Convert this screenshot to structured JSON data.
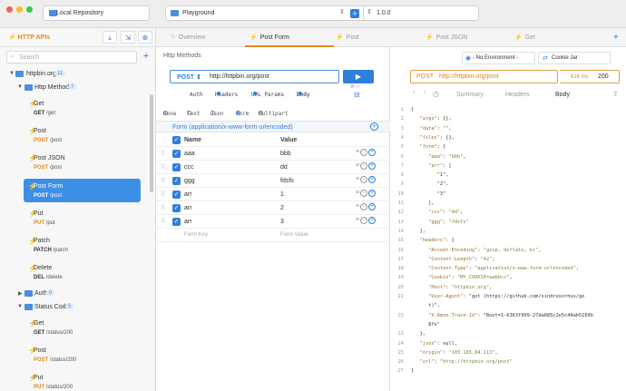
{
  "titlebar": {
    "repository": "Local Repository",
    "project": "Playground",
    "version": "1.0.0"
  },
  "sidebar": {
    "title": "HTTP APIs",
    "search_placeholder": "Search",
    "tree": {
      "root": {
        "label": "httpbin.org",
        "count": "11"
      },
      "http_methods": {
        "label": "Http Methods",
        "count": "7"
      },
      "auth": {
        "label": "Auth",
        "count": "0"
      },
      "status_codes": {
        "label": "Status Codes",
        "count": "5"
      }
    },
    "requests": [
      {
        "name": "Get",
        "method": "GET",
        "path": "/get"
      },
      {
        "name": "Post",
        "method": "POST",
        "path": "/post"
      },
      {
        "name": "Post JSON",
        "method": "POST",
        "path": "/post"
      },
      {
        "name": "Post Form",
        "method": "POST",
        "path": "/post"
      },
      {
        "name": "Put",
        "method": "PUT",
        "path": "/put"
      },
      {
        "name": "Patch",
        "method": "PATCH",
        "path": "/patch"
      },
      {
        "name": "Delete",
        "method": "DEL",
        "path": "/delete"
      }
    ],
    "status_requests": [
      {
        "name": "Get",
        "method": "GET",
        "path": "/status/200"
      },
      {
        "name": "Post",
        "method": "POST",
        "path": "/status/200"
      },
      {
        "name": "Put",
        "method": "PUT",
        "path": "/status/200"
      }
    ]
  },
  "tabs": [
    "Overview",
    "Post Form",
    "Post",
    "Post JSON",
    "Get"
  ],
  "request": {
    "breadcrumb": "Http Methods",
    "method": "POST",
    "url": "http://httpbin.org/post",
    "send_hint": "⌘ ↩",
    "subtabs": [
      "Auth",
      "Headers",
      "URL Params",
      "Body"
    ],
    "body_types": [
      "None",
      "Text",
      "Json",
      "Form",
      "Multipart"
    ],
    "form_title": "Form (application/x-www-form-urlencoded)",
    "columns": {
      "name": "Name",
      "value": "Value"
    },
    "fields": [
      {
        "name": "aaa",
        "value": "bbb"
      },
      {
        "name": "ccc",
        "value": "dd"
      },
      {
        "name": "ggg",
        "value": "fdsfs"
      },
      {
        "name": "arr",
        "value": "1"
      },
      {
        "name": "arr",
        "value": "2"
      },
      {
        "name": "arr",
        "value": "3"
      }
    ],
    "placeholder_key": "Form Key",
    "placeholder_value": "Form Value"
  },
  "response": {
    "environment": "- No Environment -",
    "cookie_jar": "Cookie Jar",
    "method": "POST",
    "url": "http://httpbin.org/post",
    "time": "616 ms",
    "status": "200",
    "tabs": [
      "Summary",
      "Headers",
      "Body"
    ],
    "lines": [
      {
        "n": "1",
        "t": "{"
      },
      {
        "n": "2",
        "t": "   \"args\": {},"
      },
      {
        "n": "3",
        "t": "   \"data\": \"\","
      },
      {
        "n": "4",
        "t": "   \"files\": {},"
      },
      {
        "n": "5",
        "t": "   \"form\": {"
      },
      {
        "n": "6",
        "t": "      \"aaa\": \"bbb\","
      },
      {
        "n": "7",
        "t": "      \"arr\": ["
      },
      {
        "n": "8",
        "t": "         \"1\","
      },
      {
        "n": "9",
        "t": "         \"2\","
      },
      {
        "n": "10",
        "t": "         \"3\""
      },
      {
        "n": "11",
        "t": "      ],"
      },
      {
        "n": "12",
        "t": "      \"ccc\": \"dd\","
      },
      {
        "n": "13",
        "t": "      \"ggg\": \"fdsfs\""
      },
      {
        "n": "14",
        "t": "   },"
      },
      {
        "n": "15",
        "t": "   \"headers\": {"
      },
      {
        "n": "16",
        "t": "      \"Accept-Encoding\": \"gzip, deflate, br\","
      },
      {
        "n": "17",
        "t": "      \"Content-Length\": \"42\","
      },
      {
        "n": "18",
        "t": "      \"Content-Type\": \"application/x-www-form-urlencoded\","
      },
      {
        "n": "19",
        "t": "      \"Cookie\": \"MY_COOKIE=aabbcc\","
      },
      {
        "n": "20",
        "t": "      \"Host\": \"httpbin.org\","
      },
      {
        "n": "21",
        "t": "      \"User-Agent\": \"got (https://github.com/sindresorhus/go"
      },
      {
        "n": "",
        "t": "      t)\","
      },
      {
        "n": "22",
        "t": "      \"X-Amzn-Trace-Id\": \"Root=1-6363f999-27da685c2e5c44ab5169b"
      },
      {
        "n": "",
        "t": "      8fe\""
      },
      {
        "n": "23",
        "t": "   },"
      },
      {
        "n": "24",
        "t": "   \"json\": null,"
      },
      {
        "n": "25",
        "t": "   \"origin\": \"103.165.84.113\","
      },
      {
        "n": "26",
        "t": "   \"url\": \"http://httpbin.org/post\""
      },
      {
        "n": "27",
        "t": "}"
      }
    ]
  },
  "colors": {
    "accent": "#2f7fd9",
    "selected": "#3d8fe6",
    "orange": "#e08a1e"
  }
}
